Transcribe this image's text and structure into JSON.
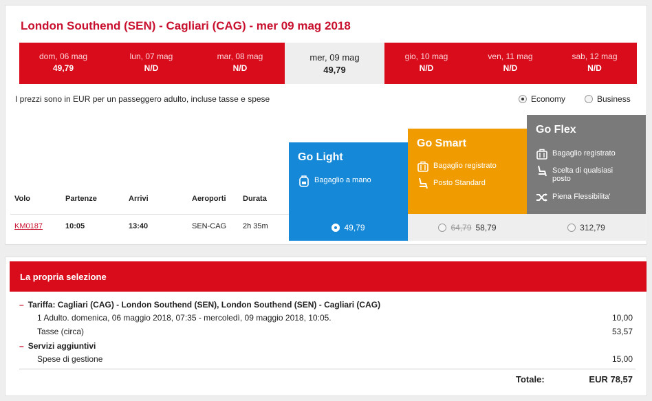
{
  "route_title": "London Southend (SEN) - Cagliari (CAG) - mer 09 mag 2018",
  "dates": [
    {
      "day": "dom, 06 mag",
      "price": "49,79"
    },
    {
      "day": "lun, 07 mag",
      "price": "N/D"
    },
    {
      "day": "mar, 08 mag",
      "price": "N/D"
    },
    {
      "day": "mer, 09 mag",
      "price": "49,79",
      "selected": true
    },
    {
      "day": "gio, 10 mag",
      "price": "N/D"
    },
    {
      "day": "ven, 11 mag",
      "price": "N/D"
    },
    {
      "day": "sab, 12 mag",
      "price": "N/D"
    }
  ],
  "price_note": "I prezzi sono in EUR per un passeggero adulto, incluse tasse e spese",
  "cabin": {
    "economy": "Economy",
    "business": "Business",
    "selected": "Economy"
  },
  "columns": {
    "volo": "Volo",
    "partenze": "Partenze",
    "arrivi": "Arrivi",
    "aeroporti": "Aeroporti",
    "durata": "Durata"
  },
  "fares": {
    "light": {
      "name": "Go Light",
      "features": [
        "Bagaglio a mano"
      ]
    },
    "smart": {
      "name": "Go Smart",
      "features": [
        "Bagaglio registrato",
        "Posto Standard"
      ]
    },
    "flex": {
      "name": "Go Flex",
      "features": [
        "Bagaglio registrato",
        "Scelta di qualsiasi posto",
        "Piena Flessibilita'"
      ]
    }
  },
  "flight": {
    "number": "KM0187",
    "departure": "10:05",
    "arrival": "13:40",
    "airports": "SEN-CAG",
    "duration": "2h 35m",
    "price_light": "49,79",
    "price_smart_old": "64,79",
    "price_smart": "58,79",
    "price_flex": "312,79"
  },
  "selection": {
    "title": "La propria selezione",
    "tariff_label": "Tariffa: Cagliari (CAG) - London Southend (SEN), London Southend (SEN) - Cagliari (CAG)",
    "tariff_detail": "1 Adulto. domenica, 06 maggio 2018, 07:35 - mercoledì, 09 maggio 2018, 10:05.",
    "tariff_value": "10,00",
    "taxes_label": "Tasse (circa)",
    "taxes_value": "53,57",
    "services_label": "Servizi aggiuntivi",
    "fees_label": "Spese di gestione",
    "fees_value": "15,00",
    "total_label": "Totale:",
    "total_value": "EUR 78,57"
  },
  "colors": {
    "brand_red": "#d90c1c",
    "light_blue": "#1588d8",
    "smart_orange": "#f09c00",
    "flex_grey": "#7a7a7a"
  },
  "icons": {
    "bag_hand": "backpack-icon",
    "bag_checked": "suitcase-icon",
    "seat": "seat-icon",
    "seat_any": "seat-select-icon",
    "flex": "shuffle-icon"
  }
}
